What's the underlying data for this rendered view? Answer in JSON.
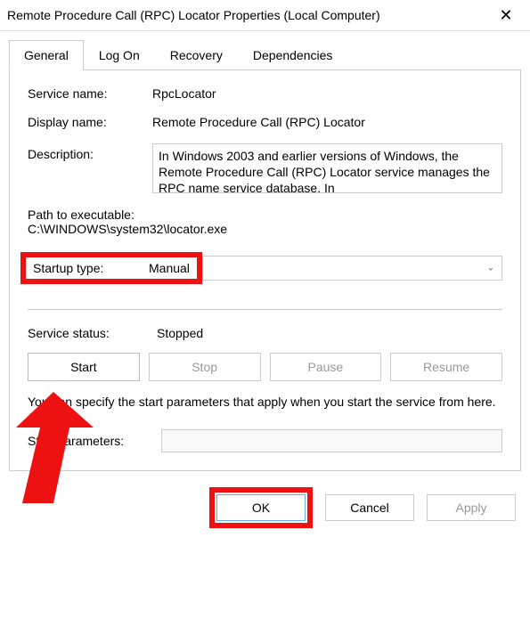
{
  "title": "Remote Procedure Call (RPC) Locator Properties (Local Computer)",
  "tabs": {
    "general": "General",
    "logon": "Log On",
    "recovery": "Recovery",
    "deps": "Dependencies"
  },
  "labels": {
    "service_name": "Service name:",
    "display_name": "Display name:",
    "description": "Description:",
    "path": "Path to executable:",
    "startup_type": "Startup type:",
    "service_status": "Service status:",
    "start_params": "Start parameters:"
  },
  "values": {
    "service_name": "RpcLocator",
    "display_name": "Remote Procedure Call (RPC) Locator",
    "description": "In Windows 2003 and earlier versions of Windows, the Remote Procedure Call (RPC) Locator service manages the RPC name service database. In",
    "path": "C:\\WINDOWS\\system32\\locator.exe",
    "startup_type": "Manual",
    "service_status": "Stopped"
  },
  "buttons": {
    "start": "Start",
    "stop": "Stop",
    "pause": "Pause",
    "resume": "Resume",
    "ok": "OK",
    "cancel": "Cancel",
    "apply": "Apply"
  },
  "hint": "You can specify the start parameters that apply when you start the service from here."
}
